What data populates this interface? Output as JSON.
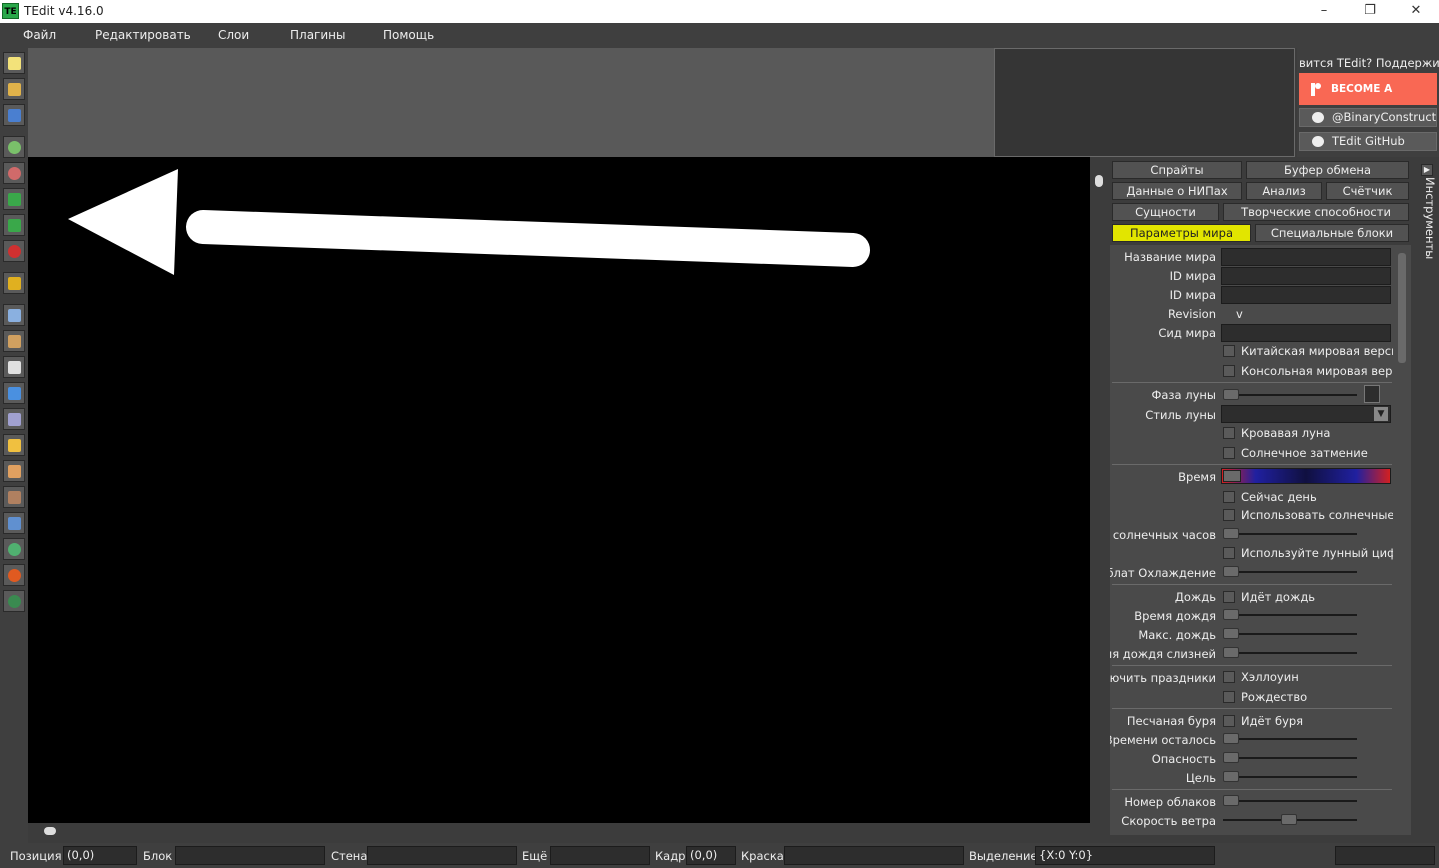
{
  "window": {
    "title": "TEdit v4.16.0",
    "icon_text": "TE",
    "min": "–",
    "max": "❐",
    "close": "✕"
  },
  "menu": [
    "Файл",
    "Редактировать",
    "Слои",
    "Плагины",
    "Помощь"
  ],
  "toolbar": [
    "new-file",
    "open-file",
    "save-file",
    "zoom-in",
    "zoom-out",
    "undo",
    "redo",
    "delete",
    "crop",
    "copy",
    "paste",
    "arrow",
    "select",
    "picker",
    "pencil",
    "brush",
    "hammer",
    "fill",
    "sphere",
    "morph",
    "sprite"
  ],
  "promo": {
    "text": "вится TEdit? Поддержите",
    "patron": "BECOME A PATRON",
    "twitter": "@BinaryConstruct",
    "github": "TEdit GitHub"
  },
  "tabs": [
    "Спрайты",
    "Буфер обмена",
    "Данные о НИПах",
    "Анализ",
    "Счётчик",
    "Сущности",
    "Творческие способности",
    "Параметры мира",
    "Специальные блоки"
  ],
  "side_tab": "Инструменты",
  "props": {
    "world_name": "Название мира",
    "world_id": "ID мира",
    "world_id2": "ID мира",
    "revision": "Revision",
    "revision_value": "v",
    "world_seed": "Сид мира",
    "chinese": "Китайская мировая версия",
    "console": "Консольная мировая версия",
    "moon_phase": "Фаза луны",
    "moon_style": "Стиль луны",
    "blood_moon": "Кровавая луна",
    "eclipse": "Солнечное затмение",
    "time": "Время",
    "daytime": "Сейчас день",
    "sundial": "Использовать солнечные часы",
    "sundial_slider": "солнечных часов",
    "moondial": "Используйте лунный циферблат",
    "cloud_cool": "облат Охлаждение",
    "rain": "Дождь",
    "raining": "Идёт дождь",
    "rain_time": "Время дождя",
    "max_rain": "Макс. дождь",
    "slime_rain": "мя дождя слизней",
    "holidays": "ючить праздники",
    "halloween": "Хэллоуин",
    "xmas": "Рождество",
    "sandstorm": "Песчаная буря",
    "storm": "Идёт буря",
    "time_left": "Времени осталось",
    "severity": "Опасность",
    "goal": "Цель",
    "clouds": "Номер облаков",
    "wind": "Скорость ветра"
  },
  "status": {
    "position": "Позиция",
    "position_value": "(0,0)",
    "block": "Блок",
    "wall": "Стена",
    "more": "Ещё",
    "frame": "Кадр",
    "frame_value": "(0,0)",
    "paint": "Краска",
    "selection": "Выделение",
    "selection_value": "{X:0 Y:0}"
  }
}
